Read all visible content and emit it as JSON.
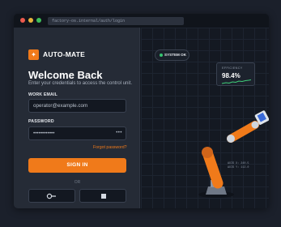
{
  "browser": {
    "url": "factory-os.internal/auth/login"
  },
  "brand": {
    "name": "AUTO-MATE"
  },
  "login": {
    "heading": "Welcome Back",
    "subheading": "Enter your credentials to access the control unit.",
    "email_label": "WORK EMAIL",
    "email_placeholder": "operator@example.com",
    "password_label": "PASSWORD",
    "password_value": "••••••••••••",
    "password_toggle": "•••",
    "forgot_label": "Forgot password?",
    "signin_label": "SIGN IN",
    "divider_label": "OR",
    "alt_buttons": [
      {
        "icon": "key-icon"
      },
      {
        "icon": "square-icon"
      }
    ]
  },
  "scene": {
    "system_status": "SYSTEM OK",
    "efficiency_label": "EFFICIENCY",
    "efficiency_value": "98.4%",
    "axis_readout": [
      "AXIS X: 240.5",
      "AXIS Y: 112.0"
    ],
    "colors": {
      "accent": "#f07a1a",
      "status_ok": "#35c56f",
      "sparkline": "#3fd07a"
    }
  }
}
